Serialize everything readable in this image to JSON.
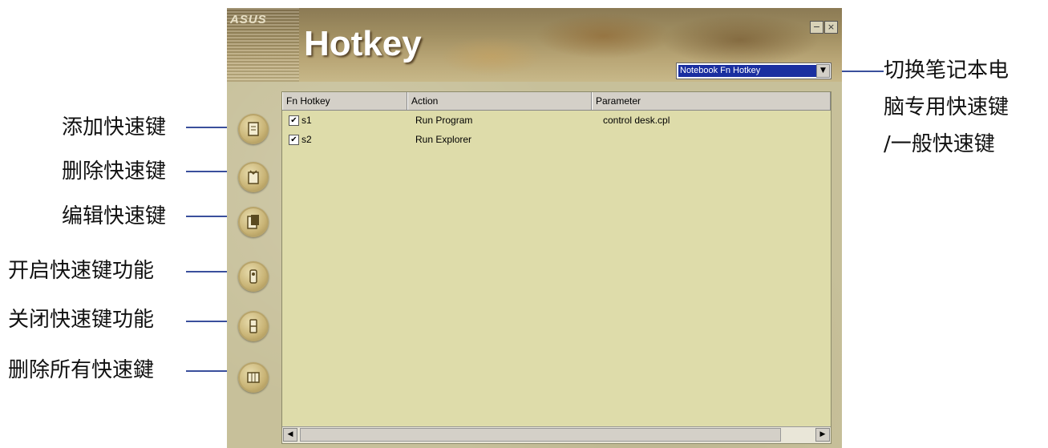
{
  "annotations": {
    "left": [
      {
        "label": "添加快速键"
      },
      {
        "label": "删除快速键"
      },
      {
        "label": "编辑快速键"
      },
      {
        "label": "开启快速键功能"
      },
      {
        "label": "关闭快速键功能"
      },
      {
        "label": "删除所有快速鍵"
      }
    ],
    "right": {
      "line1": "切换笔记本电",
      "line2": "脑专用快速键",
      "line3": "/一般快速键"
    }
  },
  "window": {
    "brand": "ASUS",
    "title": "Hotkey",
    "minimize_label": "−",
    "close_label": "×",
    "mode_select": {
      "value": "Notebook Fn Hotkey",
      "arrow": "▼"
    }
  },
  "toolbar": {
    "buttons": [
      {
        "name": "add-hotkey-button",
        "icon": "add-icon"
      },
      {
        "name": "delete-hotkey-button",
        "icon": "delete-icon"
      },
      {
        "name": "edit-hotkey-button",
        "icon": "edit-icon"
      },
      {
        "name": "enable-hotkey-button",
        "icon": "enable-icon"
      },
      {
        "name": "disable-hotkey-button",
        "icon": "disable-icon"
      },
      {
        "name": "delete-all-hotkeys-button",
        "icon": "delete-all-icon"
      }
    ]
  },
  "list": {
    "columns": [
      "Fn Hotkey",
      "Action",
      "Parameter"
    ],
    "rows": [
      {
        "checked": true,
        "hotkey": "s1",
        "action": "Run Program",
        "parameter": "control desk.cpl"
      },
      {
        "checked": true,
        "hotkey": "s2",
        "action": "Run Explorer",
        "parameter": ""
      }
    ],
    "scroll_left": "◀",
    "scroll_right": "▶",
    "check_mark": "✔"
  },
  "colors": {
    "annotation_line": "#3a4f9c",
    "selection": "#1a2fa0",
    "list_bg": "#dedcaa"
  }
}
